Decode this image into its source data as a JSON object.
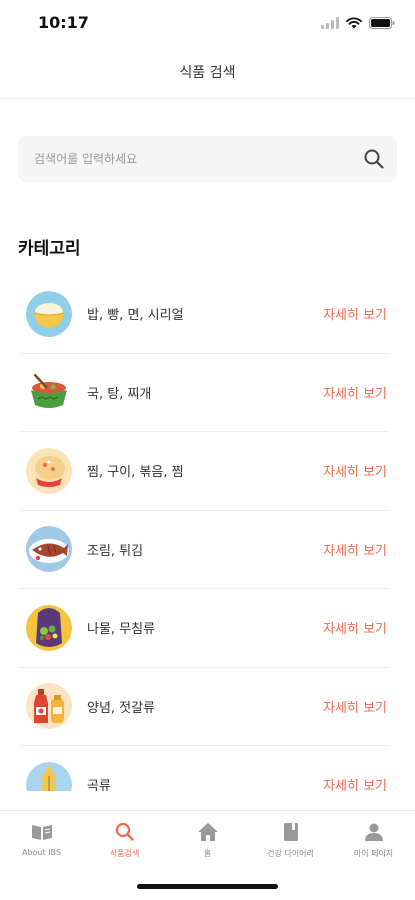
{
  "status": {
    "time": "10:17"
  },
  "header": {
    "title": "식품 검색"
  },
  "search": {
    "placeholder": "검색어를 입력하세요"
  },
  "categories": {
    "title": "카테고리",
    "more_label": "자세히 보기",
    "items": [
      {
        "label": "밥, 빵, 면, 시리얼",
        "icon": "rice-bowl-icon"
      },
      {
        "label": "국, 탕, 찌개",
        "icon": "stew-pot-icon"
      },
      {
        "label": "찜, 구이, 볶음, 찜",
        "icon": "steamed-dish-icon"
      },
      {
        "label": "조림, 튀김",
        "icon": "braised-fish-icon"
      },
      {
        "label": "나물, 무침류",
        "icon": "vegetable-salad-icon"
      },
      {
        "label": "양념, 젓갈류",
        "icon": "sauce-bottle-icon"
      },
      {
        "label": "곡류",
        "icon": "wheat-grain-icon"
      }
    ]
  },
  "tabs": [
    {
      "label": "About IBS",
      "icon": "book-open-icon",
      "active": false
    },
    {
      "label": "식품검색",
      "icon": "search-icon",
      "active": true
    },
    {
      "label": "홈",
      "icon": "home-icon",
      "active": false
    },
    {
      "label": "건강 다이어리",
      "icon": "diary-icon",
      "active": false
    },
    {
      "label": "마이 페이지",
      "icon": "person-icon",
      "active": false
    }
  ],
  "colors": {
    "accent": "#f06a4e",
    "search_bg": "#f5f5f5"
  }
}
